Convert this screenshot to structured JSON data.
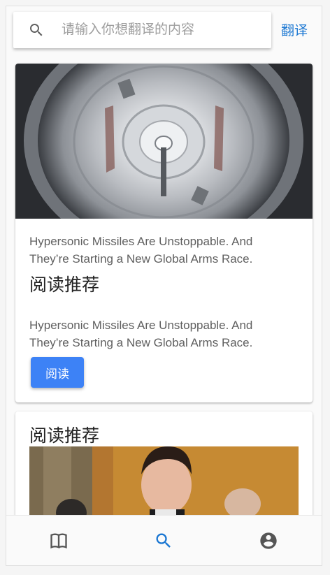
{
  "search": {
    "placeholder": "请输入你想翻译的内容",
    "value": "",
    "translate_label": "翻译"
  },
  "cards": [
    {
      "image_icon": "jet-engine-image",
      "description_top": "Hypersonic Missiles Are Unstoppable. And They’re Starting a New Global Arms Race.",
      "heading": "阅读推荐",
      "description_bottom": "Hypersonic Missiles Are Unstoppable. And They’re Starting a New Global Arms Race.",
      "button_label": "阅读"
    },
    {
      "heading": "阅读推荐",
      "image_icon": "person-photo-image"
    }
  ],
  "bottom_nav": {
    "items": [
      {
        "icon": "book-icon",
        "active": false
      },
      {
        "icon": "search-icon",
        "active": true
      },
      {
        "icon": "account-circle-icon",
        "active": false
      }
    ],
    "active_color": "#1976d2",
    "inactive_color": "#555555"
  },
  "colors": {
    "accent": "#1976d2",
    "button": "#3d82f6"
  }
}
